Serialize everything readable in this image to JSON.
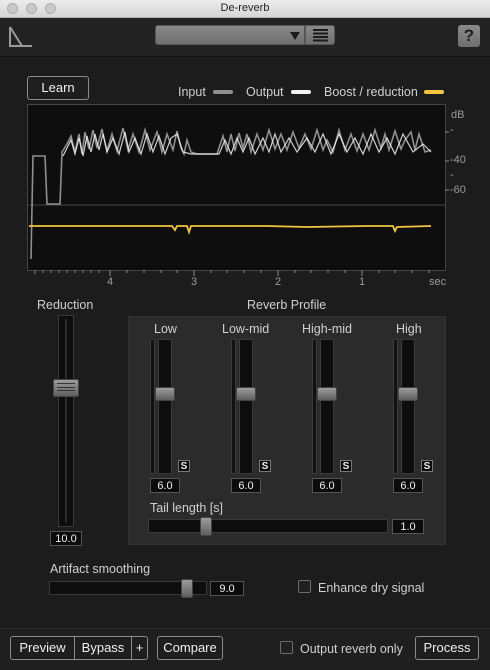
{
  "window": {
    "title": "De-reverb"
  },
  "header": {
    "preset_value": "",
    "help_label": "?"
  },
  "graph": {
    "learn_label": "Learn",
    "legend": [
      {
        "label": "Input",
        "color": "#8f8f8f"
      },
      {
        "label": "Output",
        "color": "#f2f2f2"
      },
      {
        "label": "Boost / reduction",
        "color": "#f5c542"
      }
    ],
    "db_ticks": [
      "dB",
      "-",
      "-40",
      "-",
      "-60"
    ],
    "time_ticks": [
      "4",
      "3",
      "2",
      "1",
      "sec"
    ]
  },
  "reduction": {
    "label": "Reduction",
    "value": "10.0",
    "level": 0.72
  },
  "reverb_profile": {
    "title": "Reverb Profile",
    "bands": [
      {
        "label": "Low",
        "value": "6.0",
        "solo": "S",
        "level": 0.6
      },
      {
        "label": "Low-mid",
        "value": "6.0",
        "solo": "S",
        "level": 0.6
      },
      {
        "label": "High-mid",
        "value": "6.0",
        "solo": "S",
        "level": 0.6
      },
      {
        "label": "High",
        "value": "6.0",
        "solo": "S",
        "level": 0.6
      }
    ],
    "tail_label": "Tail length [s]",
    "tail_value": "1.0",
    "tail_level": 0.2
  },
  "artifact": {
    "label": "Artifact smoothing",
    "value": "9.0",
    "level": 0.9
  },
  "enhance": {
    "label": "Enhance dry signal",
    "checked": false
  },
  "footer": {
    "preview_label": "Preview",
    "bypass_label": "Bypass",
    "plus_label": "+",
    "compare_label": "Compare",
    "output_reverb_label": "Output reverb only",
    "process_label": "Process"
  },
  "colors": {
    "accent_yellow": "#f5c542",
    "input_line": "#8f8f8f",
    "output_line": "#f2f2f2"
  }
}
